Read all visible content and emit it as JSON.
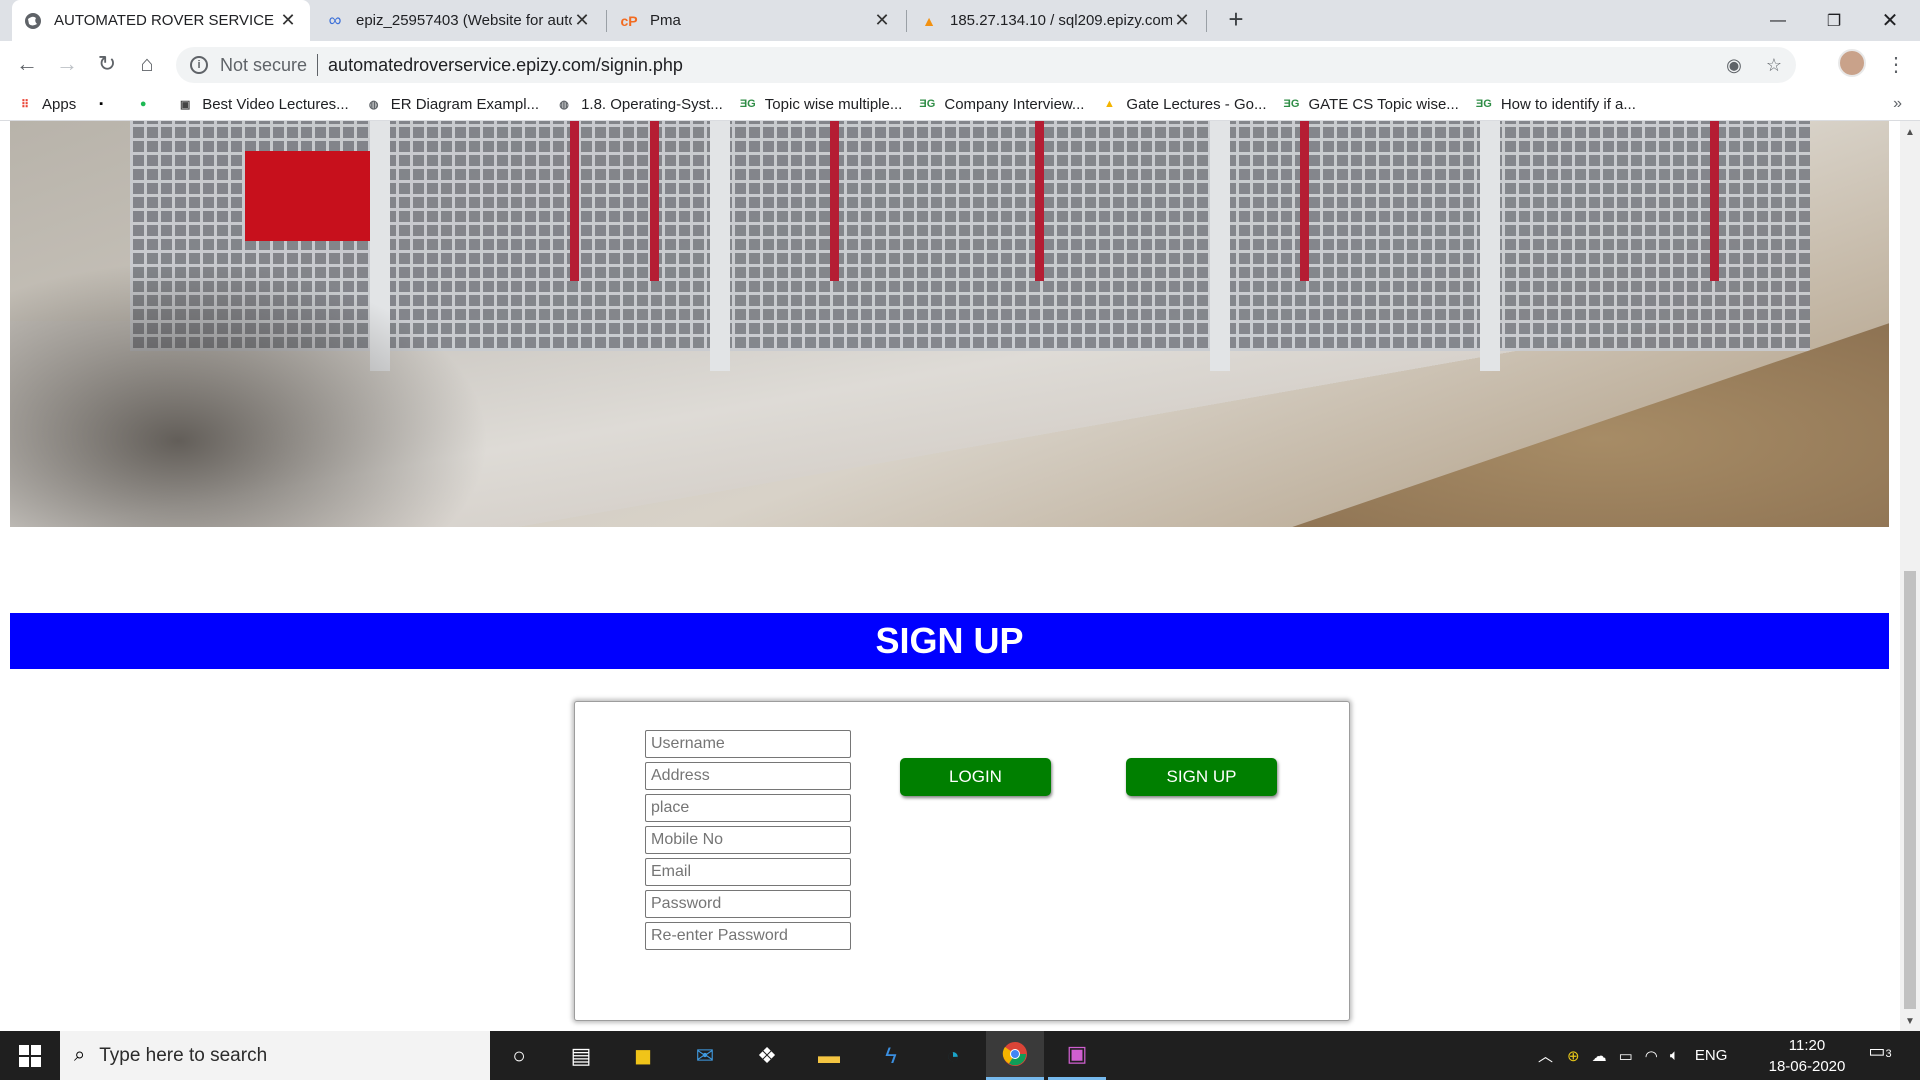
{
  "browser": {
    "tabs": [
      {
        "title": "AUTOMATED ROVER SERVICE",
        "icon": "globe-icon",
        "active": true
      },
      {
        "title": "epiz_25957403 (Website for auto",
        "icon": "infinity-icon",
        "active": false
      },
      {
        "title": "Pma",
        "icon": "cpanel-icon",
        "active": false
      },
      {
        "title": "185.27.134.10 / sql209.epizy.com",
        "icon": "phpmyadmin-icon",
        "active": false
      }
    ],
    "security_label": "Not secure",
    "url": "automatedroverservice.epizy.com/signin.php",
    "bookmarks": [
      {
        "label": "Apps",
        "icon": "apps-grid-icon"
      },
      {
        "label": "",
        "icon": "aln-icon"
      },
      {
        "label": "",
        "icon": "spotify-icon"
      },
      {
        "label": "Best Video Lectures...",
        "icon": "site-icon"
      },
      {
        "label": "ER Diagram Exampl...",
        "icon": "globe-icon"
      },
      {
        "label": "1.8. Operating-Syst...",
        "icon": "globe-icon"
      },
      {
        "label": "Topic wise multiple...",
        "icon": "gfg-icon"
      },
      {
        "label": "Company Interview...",
        "icon": "gfg-icon"
      },
      {
        "label": "Gate Lectures - Go...",
        "icon": "drive-icon"
      },
      {
        "label": "GATE CS Topic wise...",
        "icon": "gfg-icon"
      },
      {
        "label": "How to identify if a...",
        "icon": "gfg-icon"
      }
    ],
    "bookmarks_overflow": "»"
  },
  "page": {
    "banner_title": "SIGN UP",
    "form": {
      "placeholders": [
        "Username",
        "Address",
        "place",
        "Mobile No",
        "Email",
        "Password",
        "Re-enter Password"
      ],
      "login_label": "LOGIN",
      "signup_label": "SIGN UP"
    }
  },
  "taskbar": {
    "search_placeholder": "Type here to search",
    "apps": [
      "cortana-icon",
      "task-view-icon",
      "store-icon",
      "mail-icon",
      "dropbox-icon",
      "file-explorer-icon",
      "visual-studio-icon",
      "edge-icon",
      "chrome-icon",
      "tex-icon"
    ],
    "language": "ENG",
    "time": "11:20",
    "date": "18-06-2020",
    "notifications": "3"
  },
  "colors": {
    "banner": "#0000ff",
    "button": "#007f00",
    "taskbar": "#1f1f1f"
  }
}
